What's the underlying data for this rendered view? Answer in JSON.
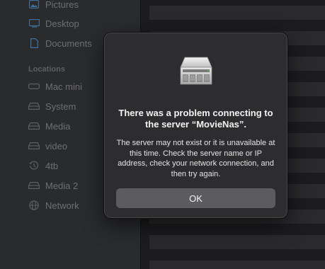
{
  "sidebar": {
    "favorites": [
      {
        "label": "Pictures",
        "icon": "pictures-icon"
      },
      {
        "label": "Desktop",
        "icon": "desktop-icon"
      },
      {
        "label": "Documents",
        "icon": "document-icon"
      }
    ],
    "locations_header": "Locations",
    "locations": [
      {
        "label": "Mac mini",
        "icon": "computer-icon"
      },
      {
        "label": "System",
        "icon": "drive-icon"
      },
      {
        "label": "Media",
        "icon": "drive-icon"
      },
      {
        "label": "video",
        "icon": "drive-icon"
      },
      {
        "label": "4tb",
        "icon": "time-machine-icon"
      },
      {
        "label": "Media 2",
        "icon": "drive-icon"
      },
      {
        "label": "Network",
        "icon": "network-icon"
      }
    ]
  },
  "dialog": {
    "icon": "server-icon",
    "title": "There was a problem connecting to the server “MovieNas”.",
    "message": "The server may not exist or it is unavailable at this time. Check the server name or IP address, check your network connection, and then try again.",
    "ok_label": "OK"
  },
  "colors": {
    "dialog_bg": "#2d2d2f",
    "button_bg": "#5c5c5f",
    "sidebar_bg": "#2a2b2d"
  }
}
